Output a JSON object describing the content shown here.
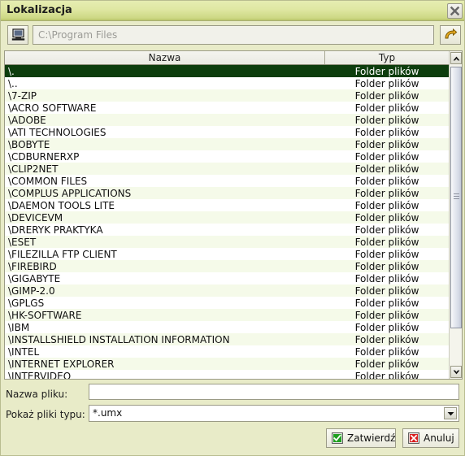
{
  "window": {
    "title": "Lokalizacja",
    "close_icon": "close-icon"
  },
  "toolbar": {
    "computer_icon": "computer-icon",
    "back_icon": "back-arrow-icon",
    "path_placeholder": "C:\\Program Files",
    "path_value": ""
  },
  "list": {
    "columns": [
      "Nazwa",
      "Typ"
    ],
    "selected_index": 0,
    "rows": [
      {
        "name": "\\.",
        "type": "Folder plików"
      },
      {
        "name": "\\..",
        "type": "Folder plików"
      },
      {
        "name": "\\7-ZIP",
        "type": "Folder plików"
      },
      {
        "name": "\\ACRO SOFTWARE",
        "type": "Folder plików"
      },
      {
        "name": "\\ADOBE",
        "type": "Folder plików"
      },
      {
        "name": "\\ATI TECHNOLOGIES",
        "type": "Folder plików"
      },
      {
        "name": "\\BOBYTE",
        "type": "Folder plików"
      },
      {
        "name": "\\CDBURNERXP",
        "type": "Folder plików"
      },
      {
        "name": "\\CLIP2NET",
        "type": "Folder plików"
      },
      {
        "name": "\\COMMON FILES",
        "type": "Folder plików"
      },
      {
        "name": "\\COMPLUS APPLICATIONS",
        "type": "Folder plików"
      },
      {
        "name": "\\DAEMON TOOLS LITE",
        "type": "Folder plików"
      },
      {
        "name": "\\DEVICEVM",
        "type": "Folder plików"
      },
      {
        "name": "\\DRERYK PRAKTYKA",
        "type": "Folder plików"
      },
      {
        "name": "\\ESET",
        "type": "Folder plików"
      },
      {
        "name": "\\FILEZILLA FTP CLIENT",
        "type": "Folder plików"
      },
      {
        "name": "\\FIREBIRD",
        "type": "Folder plików"
      },
      {
        "name": "\\GIGABYTE",
        "type": "Folder plików"
      },
      {
        "name": "\\GIMP-2.0",
        "type": "Folder plików"
      },
      {
        "name": "\\GPLGS",
        "type": "Folder plików"
      },
      {
        "name": "\\HK-SOFTWARE",
        "type": "Folder plików"
      },
      {
        "name": "\\IBM",
        "type": "Folder plików"
      },
      {
        "name": "\\INSTALLSHIELD INSTALLATION INFORMATION",
        "type": "Folder plików"
      },
      {
        "name": "\\INTEL",
        "type": "Folder plików"
      },
      {
        "name": "\\INTERNET EXPLORER",
        "type": "Folder plików"
      },
      {
        "name": "\\INTERVIDEO",
        "type": "Folder plików"
      }
    ]
  },
  "form": {
    "filename_label": "Nazwa pliku:",
    "filename_value": "",
    "filetype_label": "Pokaż pliki typu:",
    "filetype_value": "*.umx"
  },
  "buttons": {
    "ok_label": "Zatwierdź",
    "ok_icon": "check-icon",
    "cancel_label": "Anuluj",
    "cancel_icon": "cross-icon"
  },
  "colors": {
    "titlebar_start": "#e6edb2",
    "titlebar_end": "#b9c56c",
    "dialog_bg": "#e8ebc8",
    "selection": "#0d3d0d",
    "row_alt": "#f5fae9",
    "ok_green": "#22a022",
    "cancel_red": "#d82020",
    "back_arrow": "#e0a31a"
  }
}
